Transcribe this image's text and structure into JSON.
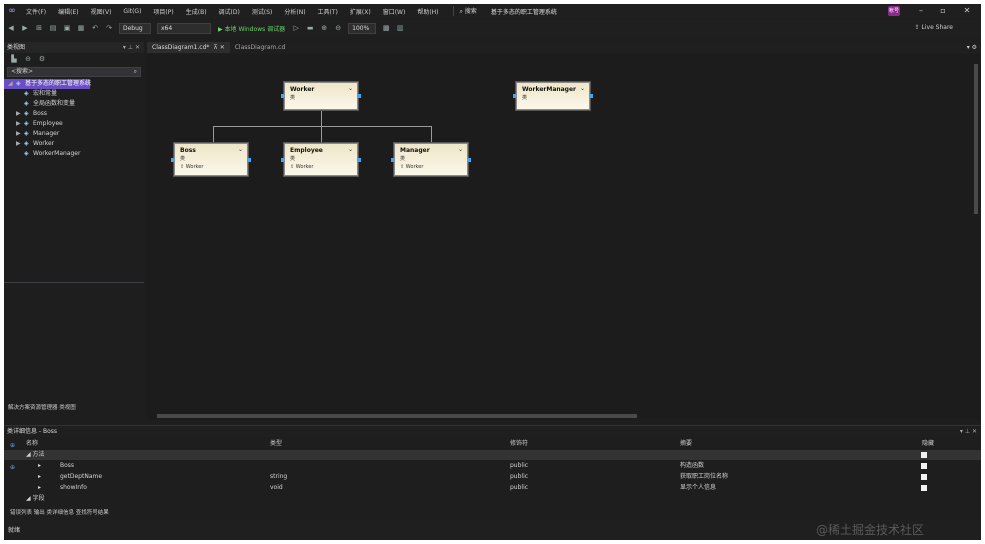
{
  "menubar": {
    "items": [
      "文件(F)",
      "编辑(E)",
      "视图(V)",
      "Git(G)",
      "项目(P)",
      "生成(B)",
      "调试(D)",
      "测试(S)",
      "分析(N)",
      "工具(T)",
      "扩展(X)",
      "窗口(W)",
      "帮助(H)"
    ],
    "search": "搜索",
    "solution_title": "基于多态的职工管理系统",
    "avatar": "帐号"
  },
  "toolbar": {
    "config": "Debug",
    "platform": "x64",
    "run": "本地 Windows 调试器",
    "zoom": "100%",
    "live_share": "Live Share"
  },
  "solution_explorer": {
    "title": "类视图",
    "search_placeholder": "<搜索>",
    "tree": [
      {
        "label": "基于多态的职工管理系统",
        "level": 0,
        "arrow": "◢",
        "selected": true
      },
      {
        "label": "宏和常量",
        "level": 1,
        "arrow": "",
        "selected": false
      },
      {
        "label": "全局函数和变量",
        "level": 1,
        "arrow": "",
        "selected": false
      },
      {
        "label": "Boss",
        "level": 1,
        "arrow": "▶",
        "selected": false
      },
      {
        "label": "Employee",
        "level": 1,
        "arrow": "▶",
        "selected": false
      },
      {
        "label": "Manager",
        "level": 1,
        "arrow": "▶",
        "selected": false
      },
      {
        "label": "Worker",
        "level": 1,
        "arrow": "▶",
        "selected": false
      },
      {
        "label": "WorkerManager",
        "level": 1,
        "arrow": "",
        "selected": false
      }
    ],
    "bottom_tabs": "解决方案资源管理器  类视图"
  },
  "document_tabs": [
    {
      "label": "ClassDiagram1.cd*",
      "active": true
    },
    {
      "label": "ClassDiagram.cd",
      "active": false
    }
  ],
  "diagram": {
    "classes": [
      {
        "name": "Worker",
        "type": "类",
        "base": ""
      },
      {
        "name": "WorkerManager",
        "type": "类",
        "base": ""
      },
      {
        "name": "Boss",
        "type": "类",
        "base": "Worker"
      },
      {
        "name": "Employee",
        "type": "类",
        "base": "Worker"
      },
      {
        "name": "Manager",
        "type": "类",
        "base": "Worker"
      }
    ]
  },
  "class_details": {
    "title": "类详细信息 - Boss",
    "columns": {
      "name": "名称",
      "type": "类型",
      "modifier": "修饰符",
      "summary": "摘要",
      "hide": "隐藏"
    },
    "group_methods": "方法",
    "group_fields": "字段",
    "rows": [
      {
        "name": "Boss",
        "type": "",
        "modifier": "public",
        "summary": "构造函数"
      },
      {
        "name": "getDeptName",
        "type": "string",
        "modifier": "public",
        "summary": "获取职工岗位名称"
      },
      {
        "name": "showInfo",
        "type": "void",
        "modifier": "public",
        "summary": "显示个人信息"
      }
    ],
    "bottom_tabs": "错误列表  输出  类详细信息  查找符号结果"
  },
  "statusbar": {
    "text": "就绪",
    "watermark": "@稀土掘金技术社区"
  }
}
